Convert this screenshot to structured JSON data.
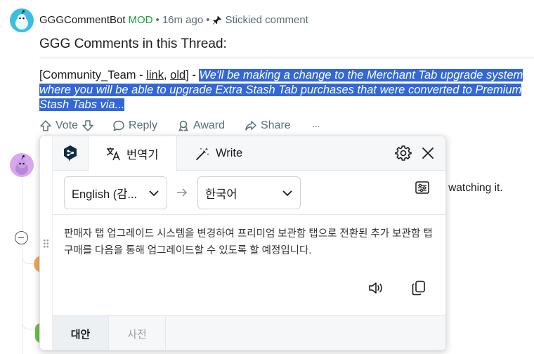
{
  "comment": {
    "username": "GGGCommentBot",
    "mod_label": "MOD",
    "separator": "•",
    "time": "16m ago",
    "stickied_label": "Stickied comment",
    "title": "GGG Comments in this Thread:",
    "quote_prefix": "[Community_Team - ",
    "link_label": "link",
    "link_sep": ", ",
    "old_label": "old",
    "quote_mid": "] - ",
    "highlighted_text": "We'll be making a change to the Merchant Tab upgrade system where you will be able to upgrade Extra Stash Tab purchases that were converted to Premium Stash Tabs via...",
    "actions": {
      "vote": "Vote",
      "reply": "Reply",
      "award": "Award",
      "share": "Share",
      "more": "···"
    }
  },
  "background_text": "er watching it.",
  "deepl": {
    "tabs": {
      "translate": "번역기",
      "write": "Write"
    },
    "source_lang": "English (감...",
    "target_lang": "한국어",
    "translation": "판매자 탭 업그레이드 시스템을 변경하여 프리미엄 보관함 탭으로 전환된 추가 보관함 탭 구매를 다음을 통해 업그레이드할 수 있도록 할 예정입니다.",
    "bottom_tabs": {
      "alternatives": "대안",
      "dictionary": "사전"
    },
    "icons": [
      "deepl-logo-icon",
      "translate-icon",
      "magic-wand-icon",
      "gear-icon",
      "close-icon",
      "arrow-right-icon",
      "glossary-settings-icon",
      "speaker-icon",
      "copy-icon"
    ]
  },
  "colors": {
    "highlight": "#3367d6",
    "mod_green": "#1e9f3a",
    "deepl_navy": "#0f2b46"
  }
}
